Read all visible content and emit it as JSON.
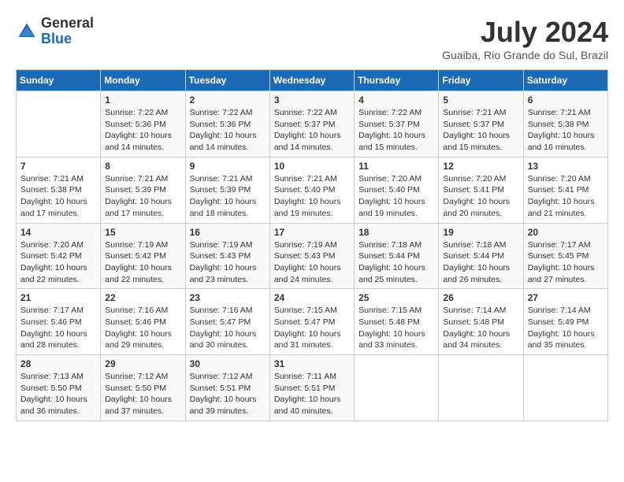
{
  "header": {
    "logo": {
      "general": "General",
      "blue": "Blue"
    },
    "title": "July 2024",
    "location": "Guaiba, Rio Grande do Sul, Brazil"
  },
  "weekdays": [
    "Sunday",
    "Monday",
    "Tuesday",
    "Wednesday",
    "Thursday",
    "Friday",
    "Saturday"
  ],
  "weeks": [
    [
      {
        "day": "",
        "sunrise": "",
        "sunset": "",
        "daylight": ""
      },
      {
        "day": "1",
        "sunrise": "Sunrise: 7:22 AM",
        "sunset": "Sunset: 5:36 PM",
        "daylight": "Daylight: 10 hours and 14 minutes."
      },
      {
        "day": "2",
        "sunrise": "Sunrise: 7:22 AM",
        "sunset": "Sunset: 5:36 PM",
        "daylight": "Daylight: 10 hours and 14 minutes."
      },
      {
        "day": "3",
        "sunrise": "Sunrise: 7:22 AM",
        "sunset": "Sunset: 5:37 PM",
        "daylight": "Daylight: 10 hours and 14 minutes."
      },
      {
        "day": "4",
        "sunrise": "Sunrise: 7:22 AM",
        "sunset": "Sunset: 5:37 PM",
        "daylight": "Daylight: 10 hours and 15 minutes."
      },
      {
        "day": "5",
        "sunrise": "Sunrise: 7:21 AM",
        "sunset": "Sunset: 5:37 PM",
        "daylight": "Daylight: 10 hours and 15 minutes."
      },
      {
        "day": "6",
        "sunrise": "Sunrise: 7:21 AM",
        "sunset": "Sunset: 5:38 PM",
        "daylight": "Daylight: 10 hours and 16 minutes."
      }
    ],
    [
      {
        "day": "7",
        "sunrise": "Sunrise: 7:21 AM",
        "sunset": "Sunset: 5:38 PM",
        "daylight": "Daylight: 10 hours and 17 minutes."
      },
      {
        "day": "8",
        "sunrise": "Sunrise: 7:21 AM",
        "sunset": "Sunset: 5:39 PM",
        "daylight": "Daylight: 10 hours and 17 minutes."
      },
      {
        "day": "9",
        "sunrise": "Sunrise: 7:21 AM",
        "sunset": "Sunset: 5:39 PM",
        "daylight": "Daylight: 10 hours and 18 minutes."
      },
      {
        "day": "10",
        "sunrise": "Sunrise: 7:21 AM",
        "sunset": "Sunset: 5:40 PM",
        "daylight": "Daylight: 10 hours and 19 minutes."
      },
      {
        "day": "11",
        "sunrise": "Sunrise: 7:20 AM",
        "sunset": "Sunset: 5:40 PM",
        "daylight": "Daylight: 10 hours and 19 minutes."
      },
      {
        "day": "12",
        "sunrise": "Sunrise: 7:20 AM",
        "sunset": "Sunset: 5:41 PM",
        "daylight": "Daylight: 10 hours and 20 minutes."
      },
      {
        "day": "13",
        "sunrise": "Sunrise: 7:20 AM",
        "sunset": "Sunset: 5:41 PM",
        "daylight": "Daylight: 10 hours and 21 minutes."
      }
    ],
    [
      {
        "day": "14",
        "sunrise": "Sunrise: 7:20 AM",
        "sunset": "Sunset: 5:42 PM",
        "daylight": "Daylight: 10 hours and 22 minutes."
      },
      {
        "day": "15",
        "sunrise": "Sunrise: 7:19 AM",
        "sunset": "Sunset: 5:42 PM",
        "daylight": "Daylight: 10 hours and 22 minutes."
      },
      {
        "day": "16",
        "sunrise": "Sunrise: 7:19 AM",
        "sunset": "Sunset: 5:43 PM",
        "daylight": "Daylight: 10 hours and 23 minutes."
      },
      {
        "day": "17",
        "sunrise": "Sunrise: 7:19 AM",
        "sunset": "Sunset: 5:43 PM",
        "daylight": "Daylight: 10 hours and 24 minutes."
      },
      {
        "day": "18",
        "sunrise": "Sunrise: 7:18 AM",
        "sunset": "Sunset: 5:44 PM",
        "daylight": "Daylight: 10 hours and 25 minutes."
      },
      {
        "day": "19",
        "sunrise": "Sunrise: 7:18 AM",
        "sunset": "Sunset: 5:44 PM",
        "daylight": "Daylight: 10 hours and 26 minutes."
      },
      {
        "day": "20",
        "sunrise": "Sunrise: 7:17 AM",
        "sunset": "Sunset: 5:45 PM",
        "daylight": "Daylight: 10 hours and 27 minutes."
      }
    ],
    [
      {
        "day": "21",
        "sunrise": "Sunrise: 7:17 AM",
        "sunset": "Sunset: 5:46 PM",
        "daylight": "Daylight: 10 hours and 28 minutes."
      },
      {
        "day": "22",
        "sunrise": "Sunrise: 7:16 AM",
        "sunset": "Sunset: 5:46 PM",
        "daylight": "Daylight: 10 hours and 29 minutes."
      },
      {
        "day": "23",
        "sunrise": "Sunrise: 7:16 AM",
        "sunset": "Sunset: 5:47 PM",
        "daylight": "Daylight: 10 hours and 30 minutes."
      },
      {
        "day": "24",
        "sunrise": "Sunrise: 7:15 AM",
        "sunset": "Sunset: 5:47 PM",
        "daylight": "Daylight: 10 hours and 31 minutes."
      },
      {
        "day": "25",
        "sunrise": "Sunrise: 7:15 AM",
        "sunset": "Sunset: 5:48 PM",
        "daylight": "Daylight: 10 hours and 33 minutes."
      },
      {
        "day": "26",
        "sunrise": "Sunrise: 7:14 AM",
        "sunset": "Sunset: 5:48 PM",
        "daylight": "Daylight: 10 hours and 34 minutes."
      },
      {
        "day": "27",
        "sunrise": "Sunrise: 7:14 AM",
        "sunset": "Sunset: 5:49 PM",
        "daylight": "Daylight: 10 hours and 35 minutes."
      }
    ],
    [
      {
        "day": "28",
        "sunrise": "Sunrise: 7:13 AM",
        "sunset": "Sunset: 5:50 PM",
        "daylight": "Daylight: 10 hours and 36 minutes."
      },
      {
        "day": "29",
        "sunrise": "Sunrise: 7:12 AM",
        "sunset": "Sunset: 5:50 PM",
        "daylight": "Daylight: 10 hours and 37 minutes."
      },
      {
        "day": "30",
        "sunrise": "Sunrise: 7:12 AM",
        "sunset": "Sunset: 5:51 PM",
        "daylight": "Daylight: 10 hours and 39 minutes."
      },
      {
        "day": "31",
        "sunrise": "Sunrise: 7:11 AM",
        "sunset": "Sunset: 5:51 PM",
        "daylight": "Daylight: 10 hours and 40 minutes."
      },
      {
        "day": "",
        "sunrise": "",
        "sunset": "",
        "daylight": ""
      },
      {
        "day": "",
        "sunrise": "",
        "sunset": "",
        "daylight": ""
      },
      {
        "day": "",
        "sunrise": "",
        "sunset": "",
        "daylight": ""
      }
    ]
  ]
}
